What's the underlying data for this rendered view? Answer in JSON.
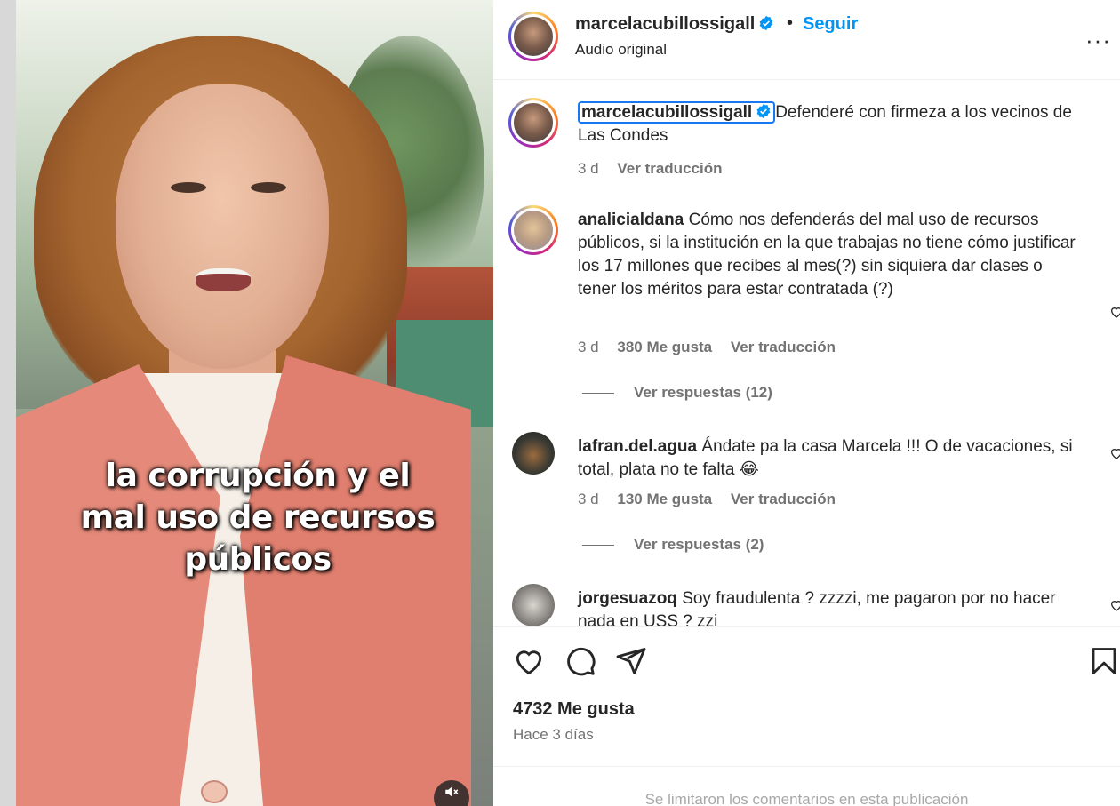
{
  "video": {
    "caption_lines": [
      "la corrupción y el",
      "mal uso de recursos",
      "públicos"
    ]
  },
  "header": {
    "username": "marcelacubillossigall",
    "separator": "•",
    "follow_label": "Seguir",
    "audio": "Audio original",
    "more": "···"
  },
  "caption": {
    "username": "marcelacubillossigall",
    "text": "Defenderé con firmeza a los vecinos de Las Condes",
    "time": "3 d",
    "translate": "Ver traducción"
  },
  "comments": [
    {
      "username": "analicialdana",
      "text": "Cómo nos defenderás del mal uso de recursos públicos, si la institución en la que trabajas no tiene cómo justificar los 17 millones que recibes al mes(?) sin siquiera dar clases o tener los méritos para estar contratada (?)",
      "time": "3 d",
      "likes": "380 Me gusta",
      "translate": "Ver traducción",
      "replies": "Ver respuestas (12)"
    },
    {
      "username": "lafran.del.agua",
      "text": "Ándate pa la casa Marcela !!! O de vacaciones, si total, plata no te falta 😂",
      "time": "3 d",
      "likes": "130 Me gusta",
      "translate": "Ver traducción",
      "replies": "Ver respuestas (2)"
    },
    {
      "username": "jorgesuazoq",
      "text": "Soy fraudulenta ? zzzzi, me pagaron por no hacer nada en USS ? zzi"
    }
  ],
  "footer": {
    "likes": "4732 Me gusta",
    "when": "Hace 3 días",
    "limited": "Se limitaron los comentarios en esta publicación"
  },
  "colors": {
    "accent": "#0095f6",
    "text": "#262626",
    "muted": "#737373",
    "verified": "#0095f6"
  }
}
